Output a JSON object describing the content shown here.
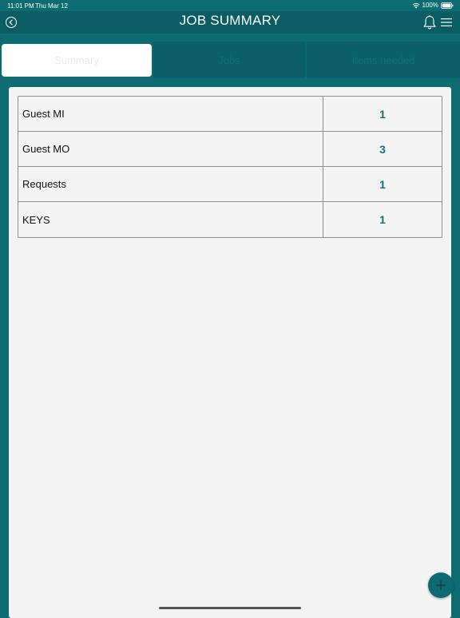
{
  "status_bar": {
    "time": "11:01 PM",
    "date": "Thu Mar 12",
    "battery": "100%"
  },
  "nav": {
    "title": "JOB SUMMARY",
    "icons": {
      "back": "back-circle-icon",
      "notifications": "bell-icon",
      "menu": "hamburger-menu-icon"
    }
  },
  "tabs": [
    {
      "label": "Summary",
      "selected": true
    },
    {
      "label": "Jobs",
      "selected": false
    },
    {
      "label": "Items needed",
      "selected": false
    }
  ],
  "summary": {
    "rows": [
      {
        "label": "Guest MI",
        "value": "1"
      },
      {
        "label": "Guest MO",
        "value": "3"
      },
      {
        "label": "Requests",
        "value": "1"
      },
      {
        "label": "KEYS",
        "value": "1"
      }
    ]
  },
  "fab": {
    "icon": "plus-icon"
  },
  "colors": {
    "primary": "#0d6b72",
    "nav_dark": "#0a5d63",
    "value_text": "#15707a",
    "panel": "#f4f4f4"
  }
}
